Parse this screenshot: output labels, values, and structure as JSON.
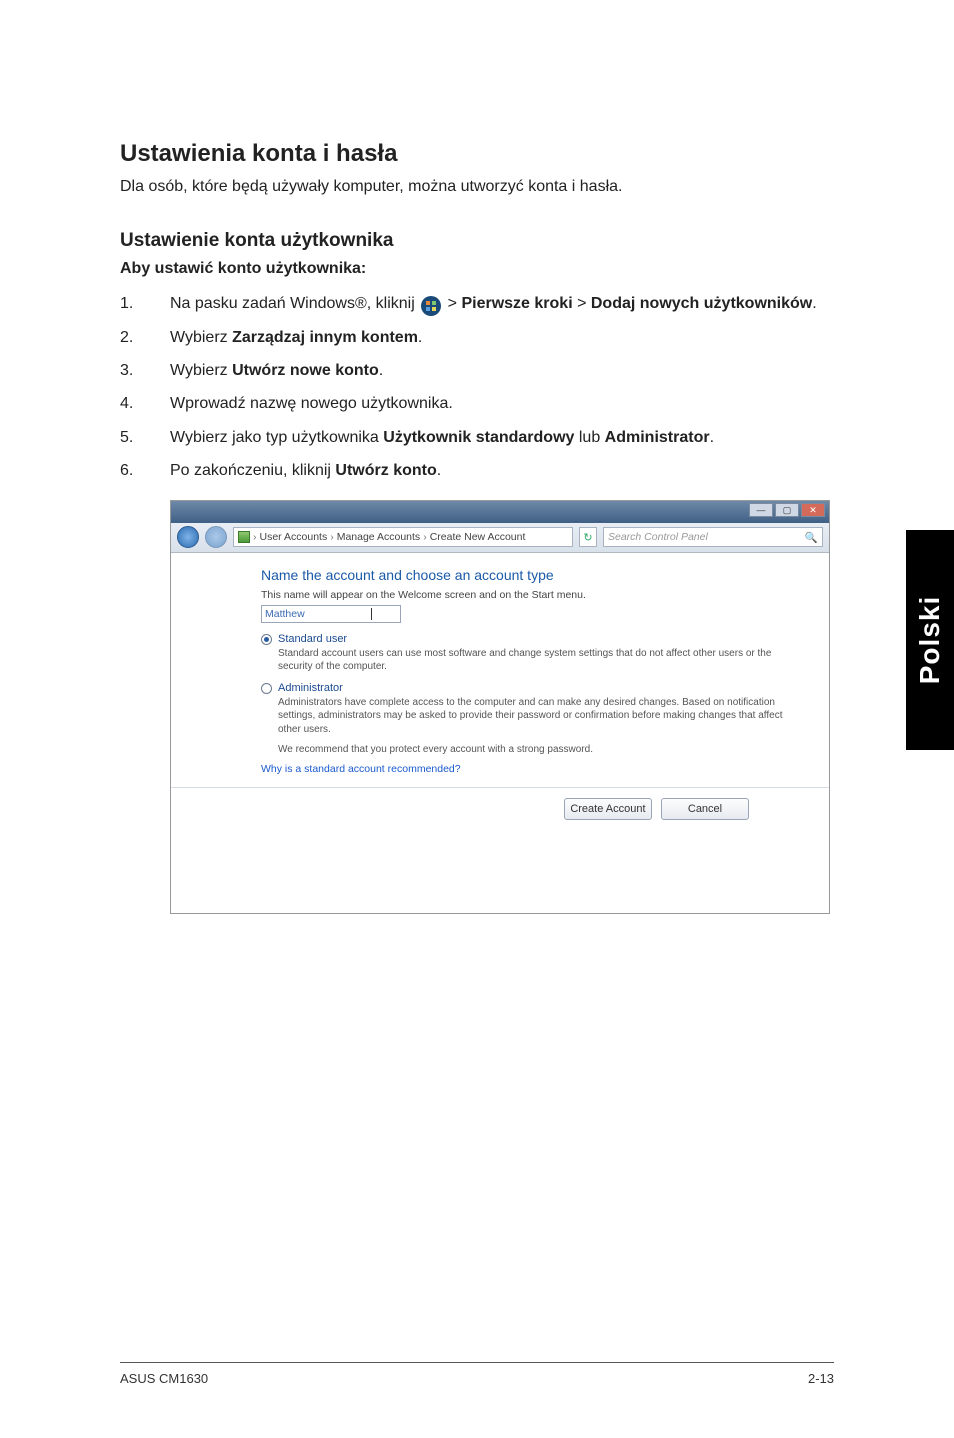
{
  "sideTab": "Polski",
  "h1": "Ustawienia konta i hasła",
  "intro": "Dla osób, które będą używały komputer, można utworzyć konta i hasła.",
  "h2": "Ustawienie konta użytkownika",
  "subbold": "Aby ustawić konto użytkownika:",
  "steps": {
    "s1_num": "1.",
    "s1_a": "Na pasku zadań Windows®, kliknij ",
    "s1_b": " > ",
    "s1_c": "Pierwsze kroki",
    "s1_d": " > ",
    "s1_e": "Dodaj nowych użytkowników",
    "s1_f": ".",
    "s2_num": "2.",
    "s2_a": "Wybierz ",
    "s2_b": "Zarządzaj innym kontem",
    "s2_c": ".",
    "s3_num": "3.",
    "s3_a": "Wybierz ",
    "s3_b": "Utwórz nowe konto",
    "s3_c": ".",
    "s4_num": "4.",
    "s4_a": "Wprowadź nazwę nowego użytkownika.",
    "s5_num": "5.",
    "s5_a": "Wybierz jako typ użytkownika ",
    "s5_b": "Użytkownik standardowy",
    "s5_c": " lub ",
    "s5_d": "Administrator",
    "s5_e": ".",
    "s6_num": "6.",
    "s6_a": "Po zakończeniu, kliknij ",
    "s6_b": "Utwórz konto",
    "s6_c": "."
  },
  "dialog": {
    "breadcrumb": {
      "a": "User Accounts",
      "b": "Manage Accounts",
      "c": "Create New Account"
    },
    "searchPlaceholder": "Search Control Panel",
    "heading": "Name the account and choose an account type",
    "subline": "This name will appear on the Welcome screen and on the Start menu.",
    "nameValue": "Matthew",
    "opt1_title": "Standard user",
    "opt1_desc": "Standard account users can use most software and change system settings that do not affect other users or the security of the computer.",
    "opt2_title": "Administrator",
    "opt2_desc": "Administrators have complete access to the computer and can make any desired changes. Based on notification settings, administrators may be asked to provide their password or confirmation before making changes that affect other users.",
    "recommend": "We recommend that you protect every account with a strong password.",
    "whyLink": "Why is a standard account recommended?",
    "btnCreate": "Create Account",
    "btnCancel": "Cancel",
    "winMin": "—",
    "winMax": "▢",
    "winClose": "✕",
    "chev": "›",
    "refresh": "↻",
    "searchIcon": "🔍"
  },
  "footer": {
    "left": "ASUS CM1630",
    "right": "2-13"
  }
}
